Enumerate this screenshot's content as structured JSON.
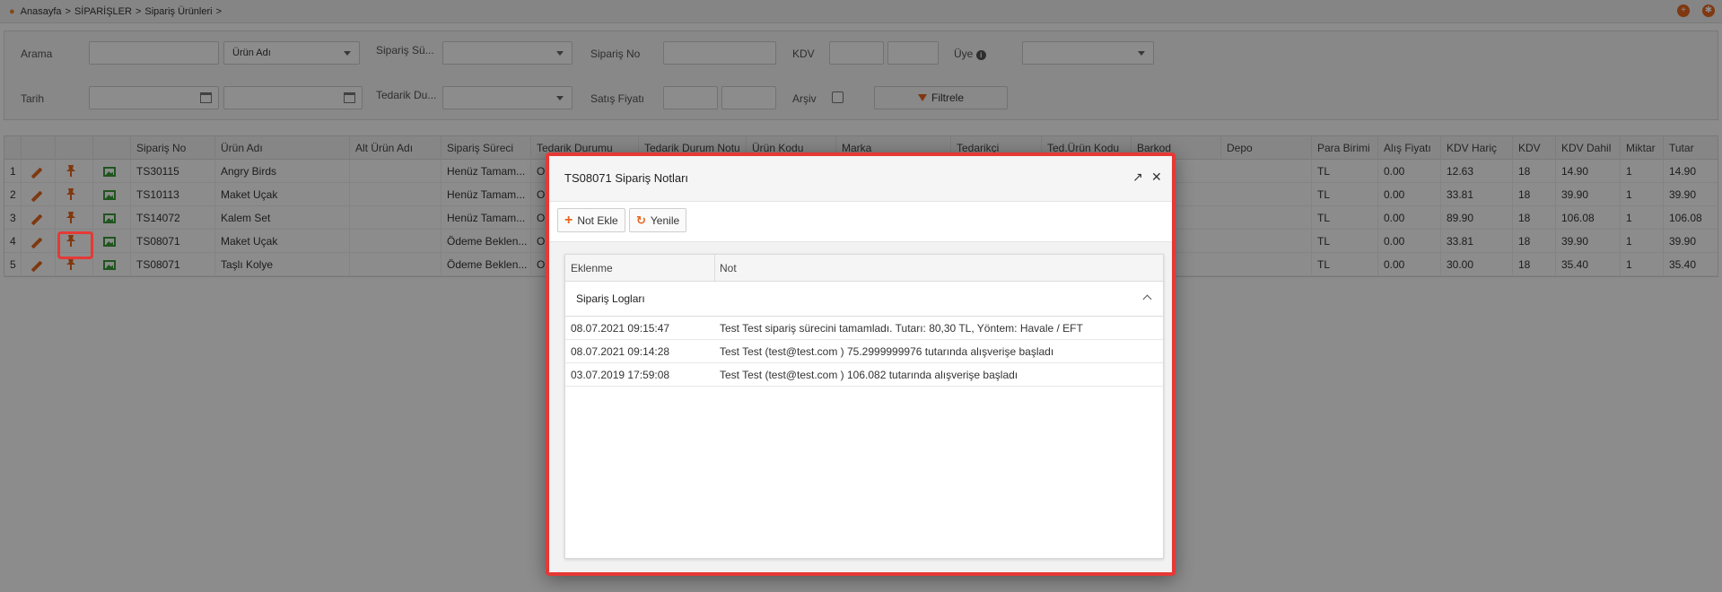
{
  "breadcrumb": [
    "Anasayfa",
    ">",
    "SİPARİŞLER",
    ">",
    "Sipariş Ürünleri",
    ">"
  ],
  "filters": {
    "arama_label": "Arama",
    "urun_adi_select": "Ürün Adı",
    "siparis_surec_label": "Sipariş Sü...",
    "siparis_no_label": "Sipariş No",
    "kdv_label": "KDV",
    "uye_label": "Üye",
    "uye_info": "i",
    "tarih_label": "Tarih",
    "tedarik_label": "Tedarik Du...",
    "satis_fiyati_label": "Satış Fiyatı",
    "arsiv_label": "Arşiv",
    "filtrele_button": "Filtrele"
  },
  "grid": {
    "headers": [
      "Sipariş No",
      "Ürün Adı",
      "Alt Ürün Adı",
      "Sipariş Süreci",
      "Tedarik Durumu",
      "Tedarik Durum Notu",
      "Ürün Kodu",
      "Marka",
      "Tedarikçi",
      "Ted.Ürün Kodu",
      "Barkod",
      "Depo",
      "Para Birimi",
      "Alış Fiyatı",
      "KDV Hariç",
      "KDV",
      "KDV Dahil",
      "Miktar",
      "Tutar"
    ],
    "rows": [
      {
        "idx": "1",
        "no": "TS30115",
        "urun": "Angry Birds",
        "alt": "",
        "surec": "Henüz Tamam...",
        "tedarik": "Ol",
        "para": "TL",
        "alis": "0.00",
        "haric": "12.63",
        "kdv": "18",
        "dahil": "14.90",
        "miktar": "1",
        "tutar": "14.90"
      },
      {
        "idx": "2",
        "no": "TS10113",
        "urun": "Maket Uçak",
        "alt": "",
        "surec": "Henüz Tamam...",
        "tedarik": "Ol",
        "para": "TL",
        "alis": "0.00",
        "haric": "33.81",
        "kdv": "18",
        "dahil": "39.90",
        "miktar": "1",
        "tutar": "39.90"
      },
      {
        "idx": "3",
        "no": "TS14072",
        "urun": "Kalem Set",
        "alt": "",
        "surec": "Henüz Tamam...",
        "tedarik": "Ol",
        "para": "TL",
        "alis": "0.00",
        "haric": "89.90",
        "kdv": "18",
        "dahil": "106.08",
        "miktar": "1",
        "tutar": "106.08"
      },
      {
        "idx": "4",
        "no": "TS08071",
        "urun": "Maket Uçak",
        "alt": "",
        "surec": "Ödeme Beklen...",
        "tedarik": "Ol",
        "para": "TL",
        "alis": "0.00",
        "haric": "33.81",
        "kdv": "18",
        "dahil": "39.90",
        "miktar": "1",
        "tutar": "39.90"
      },
      {
        "idx": "5",
        "no": "TS08071",
        "urun": "Taşlı Kolye",
        "alt": "",
        "surec": "Ödeme Beklen...",
        "tedarik": "Ol",
        "para": "TL",
        "alis": "0.00",
        "haric": "30.00",
        "kdv": "18",
        "dahil": "35.40",
        "miktar": "1",
        "tutar": "35.40"
      }
    ]
  },
  "dialog": {
    "title": "TS08071 Sipariş Notları",
    "expand_icon": "↗",
    "close_icon": "✕",
    "not_ekle": "Not Ekle",
    "yenile": "Yenile",
    "col_eklenme": "Eklenme",
    "col_not": "Not",
    "group_title": "Sipariş Logları",
    "logs": [
      {
        "date": "08.07.2021 09:15:47",
        "note": "Test Test sipariş sürecini tamamladı. Tutarı: 80,30 TL, Yöntem: Havale / EFT"
      },
      {
        "date": "08.07.2021 09:14:28",
        "note": "Test Test (test@test.com ) 75.2999999976 tutarında alışverişe başladı"
      },
      {
        "date": "03.07.2019 17:59:08",
        "note": "Test Test (test@test.com ) 106.082 tutarında alışverişe başladı"
      }
    ]
  },
  "colors": {
    "accent": "#e8661e",
    "highlight": "#e53935",
    "green": "#3a9b3a"
  }
}
